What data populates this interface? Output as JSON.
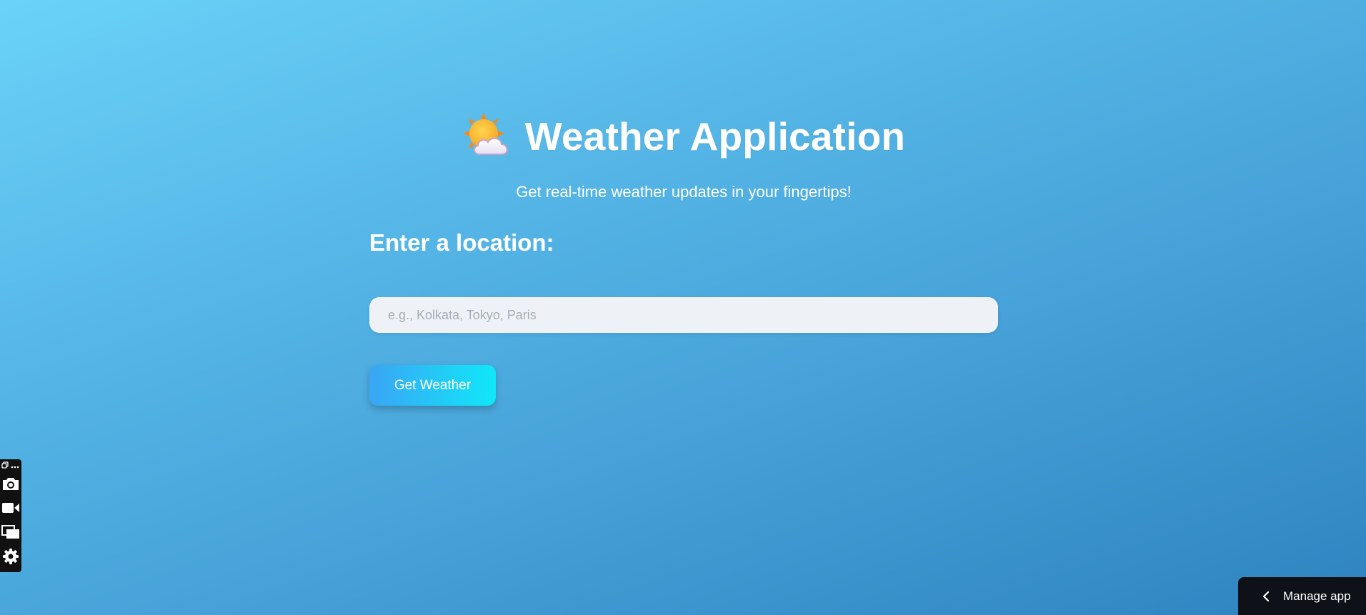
{
  "app": {
    "title": "Weather Application",
    "subtitle": "Get real-time weather updates in your fingertips!",
    "title_icon": "sun-behind-cloud-icon"
  },
  "form": {
    "label": "Enter a location:",
    "location_placeholder": "e.g., Kolkata, Tokyo, Paris",
    "location_value": "",
    "submit_label": "Get Weather"
  },
  "toolbar": {
    "icons": [
      "copy-icon",
      "more-icon",
      "camera-icon",
      "video-camera-icon",
      "windows-icon",
      "gear-icon"
    ]
  },
  "manage_app": {
    "label": "Manage app",
    "icon": "chevron-left-icon"
  },
  "colors": {
    "background_top": "#6ad2f8",
    "background_bottom": "#2e83bf",
    "button_start": "#3aa5f4",
    "button_end": "#10e8f8",
    "manage_bar": "#0e1117"
  }
}
